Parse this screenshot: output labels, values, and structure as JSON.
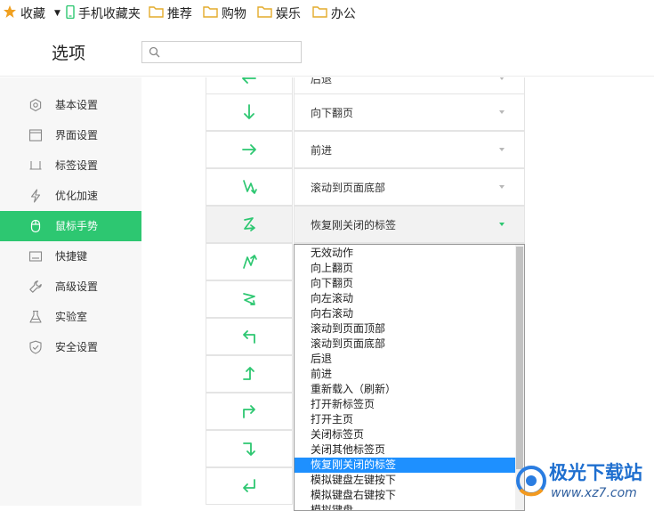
{
  "bookmarks": {
    "items": [
      {
        "label": "收藏",
        "icon": "star-icon",
        "color": "#f0a020"
      },
      {
        "label": "手机收藏夹",
        "icon": "phone-icon",
        "color": "#2dc771"
      },
      {
        "label": "推荐",
        "icon": "folder-icon",
        "color": "#f3c44d"
      },
      {
        "label": "购物",
        "icon": "folder-icon",
        "color": "#f3c44d"
      },
      {
        "label": "娱乐",
        "icon": "folder-icon",
        "color": "#f3c44d"
      },
      {
        "label": "办公",
        "icon": "folder-icon",
        "color": "#f3c44d"
      }
    ]
  },
  "header": {
    "title": "选项",
    "search_placeholder": ""
  },
  "sidebar": {
    "accent": "#2dc771",
    "items": [
      {
        "label": "基本设置",
        "icon": "hexagon-gear-icon"
      },
      {
        "label": "界面设置",
        "icon": "window-icon"
      },
      {
        "label": "标签设置",
        "icon": "tab-icon"
      },
      {
        "label": "优化加速",
        "icon": "lightning-icon"
      },
      {
        "label": "鼠标手势",
        "icon": "mouse-icon",
        "active": true
      },
      {
        "label": "快捷键",
        "icon": "keyboard-icon"
      },
      {
        "label": "高级设置",
        "icon": "wrench-icon"
      },
      {
        "label": "实验室",
        "icon": "flask-icon"
      },
      {
        "label": "安全设置",
        "icon": "shield-icon"
      }
    ]
  },
  "gestures": {
    "accent": "#2dc771",
    "rows": [
      {
        "gesture": "left-arrow-icon",
        "action": "后退"
      },
      {
        "gesture": "down-arrow-icon",
        "action": "向下翻页"
      },
      {
        "gesture": "right-arrow-icon",
        "action": "前进"
      },
      {
        "gesture": "down-up-down-icon",
        "action": "滚动到页面底部"
      },
      {
        "gesture": "z-gesture-icon",
        "action": "恢复刚关闭的标签",
        "selected": true
      },
      {
        "gesture": "up-down-up-icon",
        "action": ""
      },
      {
        "gesture": "diagonal-down-icon",
        "action": ""
      },
      {
        "gesture": "up-left-icon",
        "action": ""
      },
      {
        "gesture": "left-up-icon",
        "action": ""
      },
      {
        "gesture": "up-right-icon",
        "action": ""
      },
      {
        "gesture": "right-down-icon",
        "action": ""
      },
      {
        "gesture": "down-left-icon",
        "action": ""
      }
    ]
  },
  "dropdown": {
    "options": [
      "无效动作",
      "向上翻页",
      "向下翻页",
      "向左滚动",
      "向右滚动",
      "滚动到页面顶部",
      "滚动到页面底部",
      "后退",
      "前进",
      "重新载入（刷新）",
      "打开新标签页",
      "打开主页",
      "关闭标签页",
      "关闭其他标签页",
      "恢复刚关闭的标签",
      "模拟键盘左键按下",
      "模拟键盘右键按下",
      "模拟键盘..."
    ],
    "highlighted": "恢复刚关闭的标签",
    "highlight_color": "#1e90ff"
  },
  "watermark": {
    "text": "极光下载站",
    "url": "www.xz7.com"
  }
}
